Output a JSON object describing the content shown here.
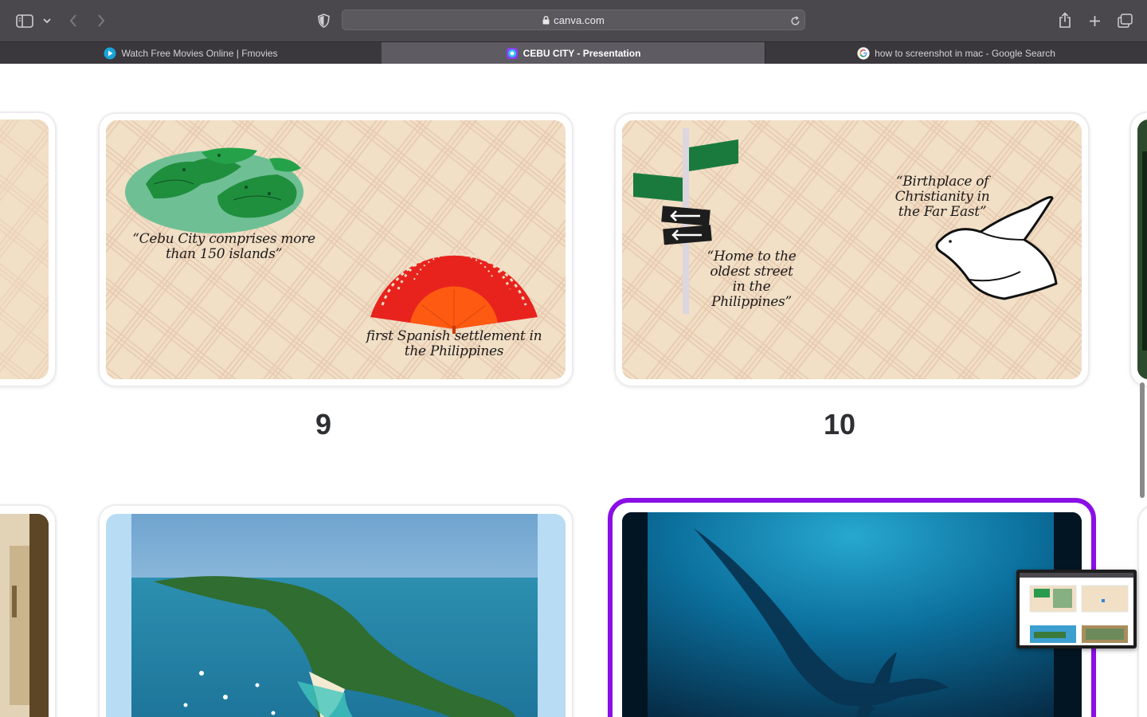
{
  "browser": {
    "url": "canva.com",
    "tabs": [
      {
        "title": "Watch Free Movies Online | Fmovies",
        "active": false,
        "icon": "fmovies-play-icon"
      },
      {
        "title": "CEBU CITY - Presentation",
        "active": true,
        "icon": "canva-icon"
      },
      {
        "title": "how to screenshot in mac - Google Search",
        "active": false,
        "icon": "google-g-icon"
      }
    ],
    "icons": [
      "sidebar-icon",
      "chevron-down-icon",
      "back-arrow-icon",
      "forward-arrow-icon",
      "privacy-shield-icon",
      "lock-icon",
      "reload-icon",
      "share-icon",
      "new-tab-plus-icon",
      "tab-overview-icon"
    ]
  },
  "slides": {
    "slide9": {
      "number": "9",
      "text_islands": "“Cebu City comprises more than 150 islands”",
      "text_settlement": "first Spanish settlement in the Philippines"
    },
    "slide10": {
      "number": "10",
      "text_street": "“Home to the oldest street in the Philippines”",
      "text_christianity": "“Birthplace of Christianity in the Far East”"
    }
  },
  "colors": {
    "selection_outline": "#8a0fe6",
    "slide_background": "#f1dfc6",
    "pattern": "#e0b9a0",
    "chrome_dark": "#4a474d"
  }
}
